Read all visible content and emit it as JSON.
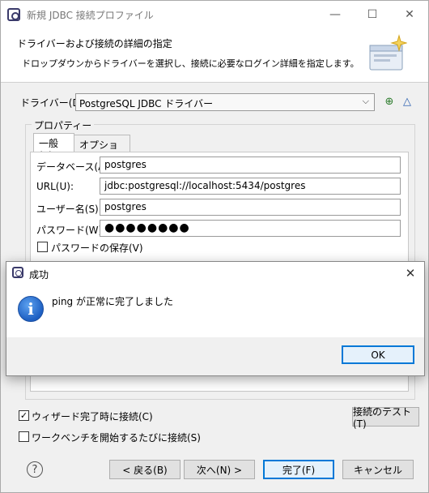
{
  "window": {
    "title": "新規 JDBC 接続プロファイル",
    "minimize": "—",
    "maximize": "☐",
    "close": "✕"
  },
  "header": {
    "title": "ドライバーおよび接続の詳細の指定",
    "description": "ドロップダウンからドライバーを選択し、接続に必要なログイン詳細を指定します。"
  },
  "driver": {
    "label": "ドライバー(D):",
    "selected": "PostgreSQL JDBC ドライバー"
  },
  "properties": {
    "group_title": "プロパティー",
    "tabs": [
      {
        "label": "一般(E)"
      },
      {
        "label": "オプション(O)"
      }
    ],
    "fields": {
      "database_label": "データベース(A):",
      "database_value": "postgres",
      "url_label": "URL(U):",
      "url_value": "jdbc:postgresql://localhost:5434/postgres",
      "user_label": "ユーザー名(S):",
      "user_value": "postgres",
      "password_label": "パスワード(W):",
      "password_value": "●●●●●●●●"
    },
    "save_password_label": "パスワードの保存(V)"
  },
  "options": {
    "connect_on_finish_label": "ウィザード完了時に接続(C)",
    "connect_on_finish_checked": true,
    "connect_on_startup_label": "ワークベンチを開始するたびに接続(S)",
    "connect_on_startup_checked": false,
    "test_connection_label": "接続のテスト(T)"
  },
  "footer": {
    "help": "?",
    "back": "< 戻る(B)",
    "next": "次へ(N) >",
    "finish": "完了(F)",
    "cancel": "キャンセル"
  },
  "popup": {
    "title": "成功",
    "message": "ping が正常に完了しました",
    "ok": "OK",
    "close": "✕"
  },
  "colors": {
    "accent": "#0078d7",
    "info_icon": "#1d5fc2"
  }
}
